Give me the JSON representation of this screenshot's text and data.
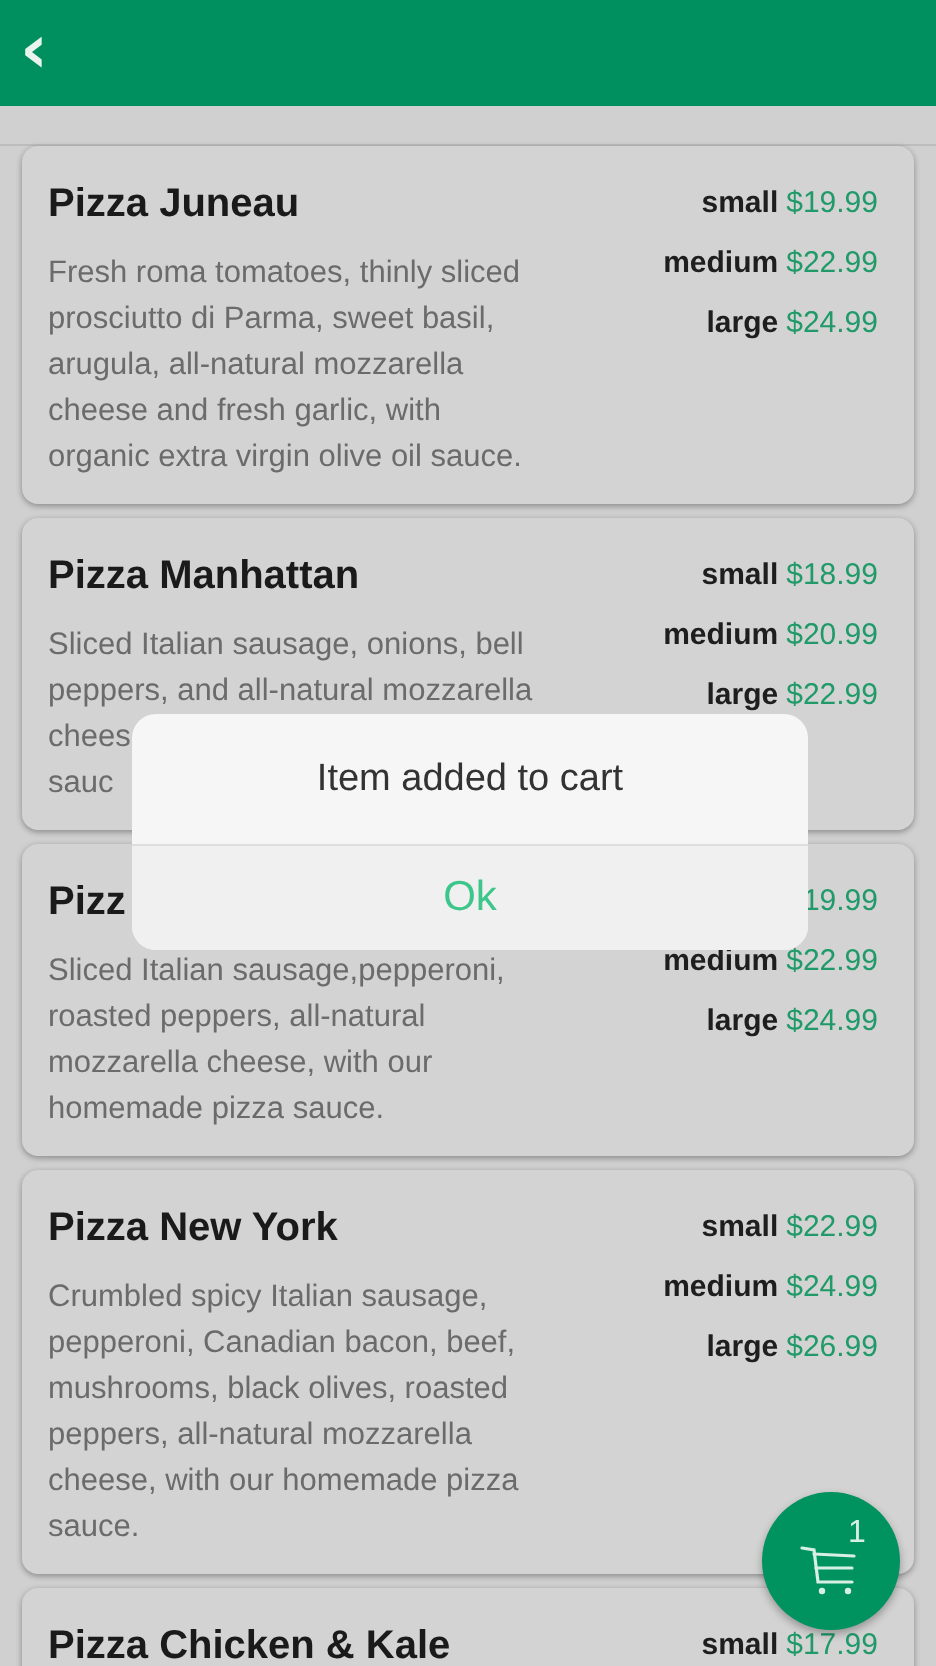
{
  "header": {
    "back": "‹"
  },
  "pizzas": [
    {
      "name": "Pizza Juneau",
      "description_lines": [
        "Fresh roma tomatoes, thinly sliced",
        "prosciutto di Parma, sweet basil,",
        "arugula, all-natural mozzarella",
        "cheese and fresh garlic, with",
        "organic extra virgin olive oil sauce."
      ],
      "prices": [
        {
          "size": "small",
          "price": "$19.99"
        },
        {
          "size": "medium",
          "price": "$22.99"
        },
        {
          "size": "large",
          "price": "$24.99"
        }
      ]
    },
    {
      "name": "Pizza Manhattan",
      "description_lines": [
        "Sliced Italian sausage, onions, bell",
        "peppers, and all-natural mozzarella",
        "chees",
        "sauc"
      ],
      "prices": [
        {
          "size": "small",
          "price": "$18.99"
        },
        {
          "size": "medium",
          "price": "$20.99"
        },
        {
          "size": "large",
          "price": "$22.99"
        }
      ]
    },
    {
      "name": "Pizz",
      "description_lines": [
        "Sliced Italian sausage,pepperoni,",
        "roasted peppers, all-natural",
        "mozzarella cheese, with our",
        "homemade pizza sauce."
      ],
      "prices": [
        {
          "price": "19.99"
        },
        {
          "size": "medium",
          "price": "$22.99"
        },
        {
          "size": "large",
          "price": "$24.99"
        }
      ]
    },
    {
      "name": "Pizza New York",
      "description_lines": [
        "Crumbled spicy Italian sausage,",
        "pepperoni, Canadian bacon, beef,",
        "mushrooms, black olives, roasted",
        "peppers, all-natural mozzarella",
        "cheese, with our homemade pizza",
        "sauce."
      ],
      "prices": [
        {
          "size": "small",
          "price": "$22.99"
        },
        {
          "size": "medium",
          "price": "$24.99"
        },
        {
          "size": "large",
          "price": "$26.99"
        }
      ]
    },
    {
      "name": "Pizza Chicken & Kale",
      "prices": [
        {
          "size": "small",
          "price": "$17.99"
        }
      ]
    }
  ],
  "cart": {
    "count": "1"
  },
  "dialog": {
    "message": "Item added to cart",
    "button": "Ok"
  }
}
